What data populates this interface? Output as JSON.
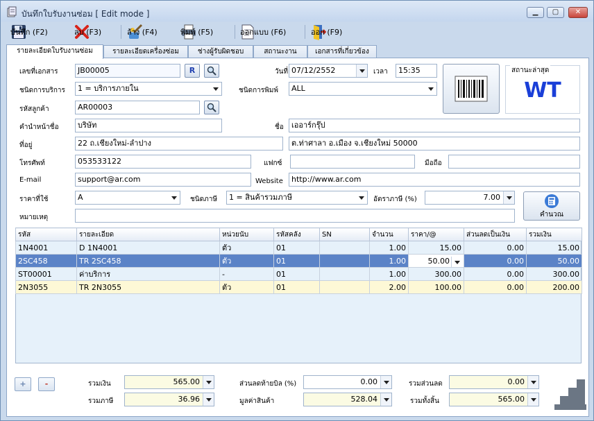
{
  "window": {
    "title": "บันทึกใบรับงานซ่อม [ Edit mode ]",
    "min_glyph": "▁",
    "max_glyph": "▢",
    "close_glyph": "✕"
  },
  "toolbar": {
    "save_label": "บันทึก (F2)",
    "delete_label": "ลบ (F3)",
    "clear_label": "ล้าง (F4)",
    "print_label": "พิมพ์ (F5)",
    "design_label": "ออกแบบ (F6)",
    "exit_label": "ออก (F9)"
  },
  "tabs": [
    {
      "label": "รายละเอียดใบรับงานซ่อม"
    },
    {
      "label": "รายละเอียดเครื่องซ่อม"
    },
    {
      "label": "ช่างผู้รับผิดชอบ"
    },
    {
      "label": "สถานะงาน"
    },
    {
      "label": "เอกสารที่เกี่ยวข้อง"
    }
  ],
  "form": {
    "doc_no": {
      "label": "เลขที่เอกสาร",
      "value": "JB00005",
      "r_button": "R"
    },
    "date": {
      "label": "วันที่",
      "value": "07/12/2552"
    },
    "time": {
      "label": "เวลา",
      "value": "15:35"
    },
    "service_type": {
      "label": "ชนิดการบริการ",
      "value": "1 = บริการภายใน"
    },
    "print_type": {
      "label": "ชนิดการพิมพ์",
      "value": "ALL"
    },
    "customer_code": {
      "label": "รหัสลูกค้า",
      "value": "AR00003"
    },
    "prefix": {
      "label": "คำนำหน้าชื่อ",
      "value": "บริษัท"
    },
    "name": {
      "label": "ชื่อ",
      "value": "เออาร์กรุ๊ป"
    },
    "address": {
      "label": "ที่อยู่",
      "value1": "22 ถ.เชียงใหม่-ลำปาง",
      "value2": "ต.ท่าศาลา อ.เมือง จ.เชียงใหม่ 50000"
    },
    "phone": {
      "label": "โทรศัพท์",
      "value": "053533122"
    },
    "fax": {
      "label": "แฟกซ์",
      "value": ""
    },
    "mobile": {
      "label": "มือถือ",
      "value": ""
    },
    "email": {
      "label": "E-mail",
      "value": "support@ar.com"
    },
    "website": {
      "label": "Website",
      "value": "http://www.ar.com"
    },
    "price_level": {
      "label": "ราคาที่ใช้",
      "value": "A"
    },
    "tax_type": {
      "label": "ชนิดภาษี",
      "value": "1 = สินค้ารวมภาษี"
    },
    "tax_rate": {
      "label": "อัตราภาษี (%)",
      "value": "7.00"
    },
    "note": {
      "label": "หมายเหตุ",
      "value": ""
    },
    "calc_label": "คำนวณ"
  },
  "status": {
    "label": "สถานะล่าสุด",
    "value": "WT",
    "color": "#1a3fd8"
  },
  "grid": {
    "columns": [
      "รหัส",
      "รายละเอียด",
      "หน่วยนับ",
      "รหัสคลัง",
      "SN",
      "จำนวน",
      "ราคา/@",
      "ส่วนลดเป็นเงิน",
      "รวมเงิน"
    ],
    "rows": [
      {
        "code": "1N4001",
        "desc": "D 1N4001",
        "unit": "ตัว",
        "wh": "01",
        "sn": "",
        "qty": "1.00",
        "price": "15.00",
        "disc": "0.00",
        "total": "15.00"
      },
      {
        "code": "2SC458",
        "desc": "TR 2SC458",
        "unit": "ตัว",
        "wh": "01",
        "sn": "",
        "qty": "1.00",
        "price": "50.00",
        "disc": "0.00",
        "total": "50.00"
      },
      {
        "code": "ST00001",
        "desc": "ค่าบริการ",
        "unit": "-",
        "wh": "01",
        "sn": "",
        "qty": "1.00",
        "price": "300.00",
        "disc": "0.00",
        "total": "300.00"
      },
      {
        "code": "2N3055",
        "desc": "TR 2N3055",
        "unit": "ตัว",
        "wh": "01",
        "sn": "",
        "qty": "2.00",
        "price": "100.00",
        "disc": "0.00",
        "total": "200.00"
      }
    ]
  },
  "footer": {
    "add_glyph": "+",
    "remove_glyph": "-",
    "subtotal": {
      "label": "รวมเงิน",
      "value": "565.00"
    },
    "tax_total": {
      "label": "รวมภาษี",
      "value": "36.96"
    },
    "bill_discount": {
      "label": "ส่วนลดท้ายบิล (%)",
      "value": "0.00"
    },
    "goods_value": {
      "label": "มูลค่าสินค้า",
      "value": "528.04"
    },
    "total_discount": {
      "label": "รวมส่วนลด",
      "value": "0.00"
    },
    "grand_total": {
      "label": "รวมทั้งสิ้น",
      "value": "565.00"
    }
  }
}
